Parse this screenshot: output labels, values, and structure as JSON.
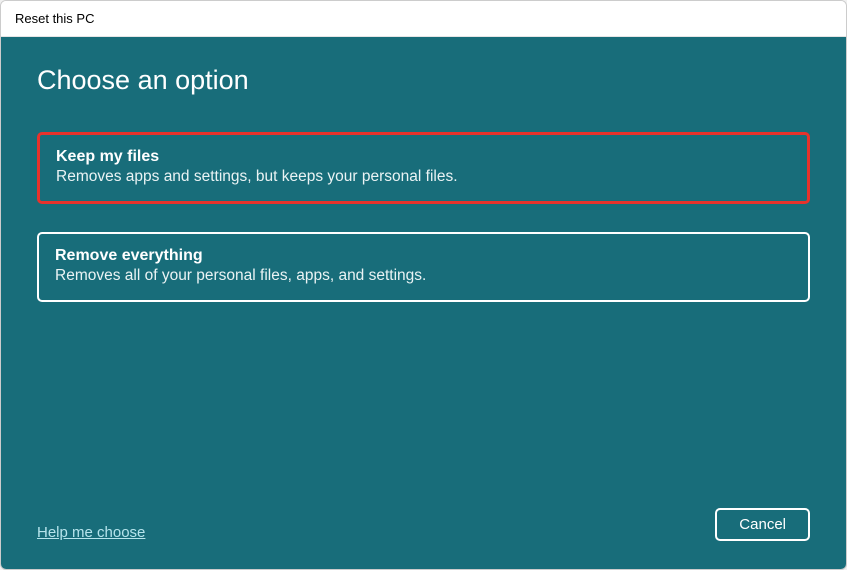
{
  "window": {
    "title": "Reset this PC"
  },
  "main": {
    "heading": "Choose an option",
    "options": [
      {
        "title": "Keep my files",
        "description": "Removes apps and settings, but keeps your personal files."
      },
      {
        "title": "Remove everything",
        "description": "Removes all of your personal files, apps, and settings."
      }
    ]
  },
  "footer": {
    "help_label": "Help me choose",
    "cancel_label": "Cancel"
  }
}
